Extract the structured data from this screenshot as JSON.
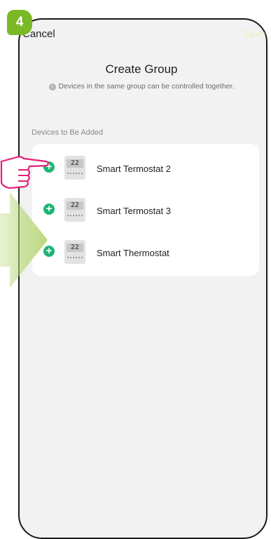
{
  "step_number": "4",
  "header": {
    "cancel_label": "Cancel",
    "save_label": "Save"
  },
  "title": "Create Group",
  "subtitle": "Devices in the same group can be controlled together.",
  "section_label": "Devices to Be Added",
  "devices": [
    {
      "name": "Smart Termostat 2",
      "display": "22"
    },
    {
      "name": "Smart Termostat 3",
      "display": "22"
    },
    {
      "name": "Smart Thermostat",
      "display": "22"
    }
  ],
  "colors": {
    "step_badge": "#7ab826",
    "add_button": "#1fb574",
    "save_disabled": "#e9eec2",
    "hand_outline": "#e5207a",
    "arrow": "#b9d77a"
  }
}
